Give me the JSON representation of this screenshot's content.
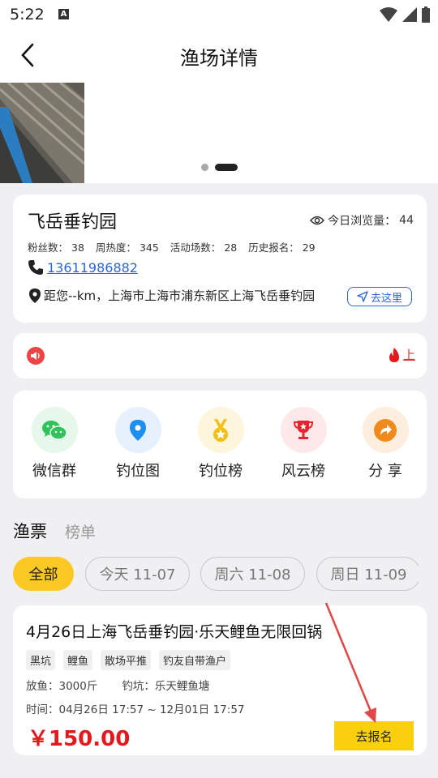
{
  "status_bar": {
    "time": "5:22"
  },
  "header": {
    "title": "渔场详情"
  },
  "venue": {
    "name": "飞岳垂钓园",
    "views_label": "今日浏览量：",
    "views_value": "44",
    "stats": [
      {
        "label": "粉丝数：",
        "value": "38"
      },
      {
        "label": "周热度：",
        "value": "345"
      },
      {
        "label": "活动场数：",
        "value": "28"
      },
      {
        "label": "历史报名：",
        "value": "29"
      }
    ],
    "phone": "13611986882",
    "address": "距您--km，上海市上海市浦东新区上海飞岳垂钓园",
    "navigate_label": "去这里"
  },
  "notice": {
    "text": "上"
  },
  "quick_actions": [
    {
      "label": "微信群",
      "icon": "wechat-icon",
      "bg": "#e6f8ec"
    },
    {
      "label": "钓位图",
      "icon": "location-pin-icon",
      "bg": "#e6f1fd"
    },
    {
      "label": "钓位榜",
      "icon": "medal-icon",
      "bg": "#fdf6dc"
    },
    {
      "label": "风云榜",
      "icon": "trophy-icon",
      "bg": "#fde9e9"
    },
    {
      "label": "分 享",
      "icon": "share-icon",
      "bg": "#fdeede"
    }
  ],
  "tabs": [
    {
      "label": "渔票"
    },
    {
      "label": "榜单"
    }
  ],
  "date_filters": [
    {
      "label": "全部"
    },
    {
      "label": "今天 11-07"
    },
    {
      "label": "周六 11-08"
    },
    {
      "label": "周日 11-09"
    }
  ],
  "ticket": {
    "title": "4月26日上海飞岳垂钓园·乐天鲤鱼无限回锅",
    "tags": [
      "黑坑",
      "鲤鱼",
      "散场平推",
      "钓友自带渔户"
    ],
    "fish_release": "放鱼：3000斤",
    "pond": "钓坑：乐天鲤鱼塘",
    "time": "时间：04月26日 17:57 ~ 12月01日 17:57",
    "price": "￥150.00",
    "signup_label": "去报名"
  },
  "colors": {
    "accent_yellow": "#fcc823",
    "price_red": "#e4191c",
    "link_blue": "#2b66d9",
    "annotation_arrow": "#e04848"
  }
}
